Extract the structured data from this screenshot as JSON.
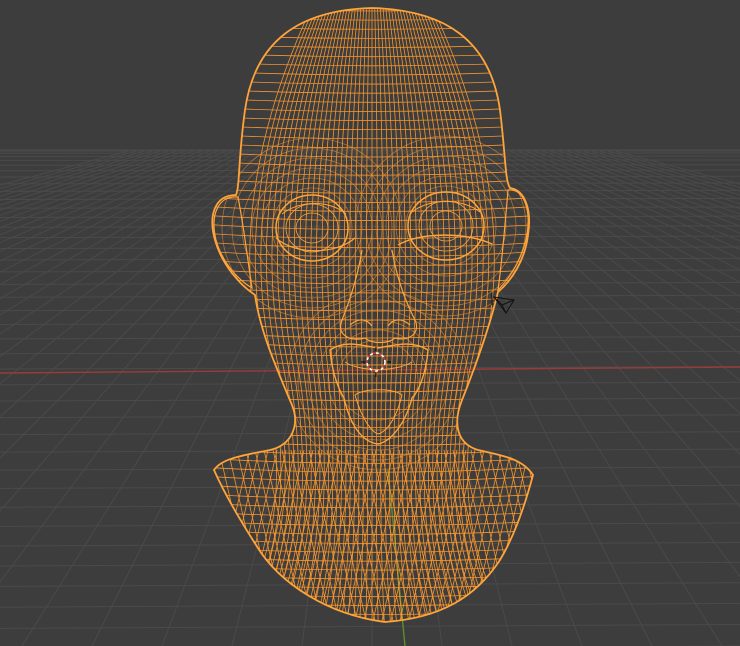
{
  "viewport": {
    "kind": "3d-viewport-wireframe",
    "view": "perspective",
    "background_color": "#3d3d3d",
    "grid_color": "#4a4a4a",
    "x_axis_color": "#9a3b3b",
    "y_axis_color": "#5a8f2e",
    "selection_color": "#ff9a2e",
    "object": {
      "name_visible": false,
      "type": "head-mesh",
      "display": "wireframe",
      "selected": true
    },
    "widgets": {
      "cursor_3d": "3d-cursor-icon",
      "camera": "camera-icon"
    }
  }
}
